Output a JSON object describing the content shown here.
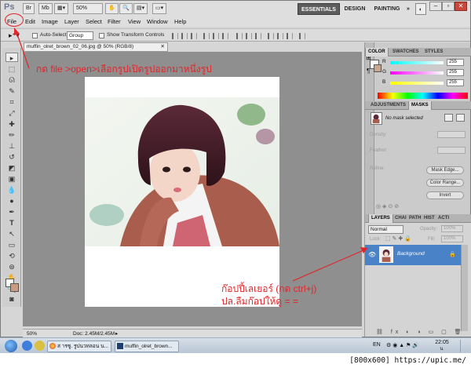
{
  "menubar": {
    "logo": "Ps",
    "items": [
      "File",
      "Edit",
      "Image",
      "Layer",
      "Select",
      "Filter",
      "View",
      "Window",
      "Help"
    ],
    "zoom": "50%",
    "workspaces": [
      "ESSENTIALS",
      "DESIGN",
      "PAINTING",
      "»"
    ]
  },
  "options": {
    "auto_select_label": "Auto-Select:",
    "auto_select_value": "Group",
    "show_transform_label": "Show Transform Controls"
  },
  "document": {
    "tab_title": "muffin_olret_brown_02_06.jpg @ 50% (RGB/8)",
    "status_zoom": "50%",
    "status_doc": "Doc: 2.45M/2.45M"
  },
  "color_panel": {
    "tabs": [
      "COLOR",
      "SWATCHES",
      "STYLES"
    ],
    "sliders": [
      {
        "letter": "R",
        "value": "255"
      },
      {
        "letter": "G",
        "value": "255"
      },
      {
        "letter": "B",
        "value": "255"
      }
    ]
  },
  "masks_panel": {
    "tabs": [
      "ADJUSTMENTS",
      "MASKS"
    ],
    "no_mask": "No mask selected",
    "density": "Density:",
    "feather": "Feather:",
    "refine": "Refine:",
    "buttons": [
      "Mask Edge...",
      "Color Range...",
      "Invert"
    ]
  },
  "layers_panel": {
    "tabs": [
      "LAYERS",
      "CHAI",
      "PATH",
      "HIST",
      "ACTI"
    ],
    "blend_mode": "Normal",
    "opacity_label": "Opacity:",
    "opacity": "100%",
    "lock_label": "Lock:",
    "fill_label": "Fill:",
    "fill": "100%",
    "layer_name": "Background"
  },
  "annotations": {
    "top": "กด file >open>เลือกรูปเปิดรูปออกมาหนึ่งรูป",
    "bottom_line1": "ก๊อปปี้เลเยอร์ (กด ctrl+j)",
    "bottom_line2": "ปล.ลืมก๊อปให้ดู = ="
  },
  "taskbar": {
    "items": [
      "ส ารซู. รูปนวทลอน น...",
      "muffin_olret_brown..."
    ],
    "lang": "EN",
    "time": "22:05",
    "period": "น."
  },
  "footer": "[800x600] https://upic.me/"
}
